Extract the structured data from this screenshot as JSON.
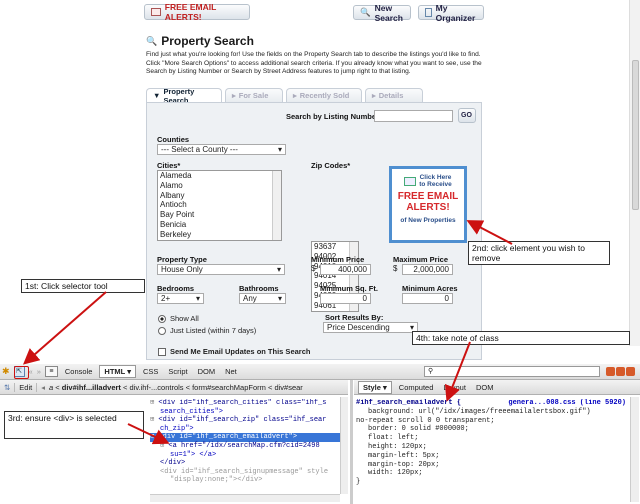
{
  "buttons": {
    "email_alerts": "FREE EMAIL ALERTS!",
    "new_search": "New Search",
    "organizer": "My Organizer"
  },
  "page": {
    "title": "Property Search",
    "intro": "Find just what you're looking for! Use the fields on the Property Search tab to describe the listings you'd like to find. Click \"More Search Options\" to access additional search criteria. If you already know what you want to see, use the Search by Listing Number or Search by Street Address features to jump right to that listing."
  },
  "tabs": [
    "Property Search",
    "For Sale",
    "Recently Sold",
    "Details"
  ],
  "listing": {
    "label": "Search by Listing Number:",
    "go": "GO"
  },
  "counties": {
    "label": "Counties",
    "selected": "--- Select a County ---"
  },
  "cities": {
    "label": "Cities*",
    "items": [
      "Alameda",
      "Alamo",
      "Albany",
      "Antioch",
      "Bay Point",
      "Benicia",
      "Berkeley"
    ]
  },
  "zips": {
    "label": "Zip Codes*",
    "items": [
      "93637",
      "94002",
      "94010",
      "94014",
      "94025",
      "94030",
      "94061"
    ]
  },
  "ad": {
    "click": "Click Here",
    "receive": "to Receive",
    "line1": "FREE EMAIL",
    "line2": "ALERTS!",
    "footer": "of New Properties"
  },
  "property_type": {
    "label": "Property Type",
    "value": "House Only"
  },
  "min_price": {
    "label": "Minimum Price",
    "currency": "$",
    "value": "400,000"
  },
  "max_price": {
    "label": "Maximum Price",
    "currency": "$",
    "value": "2,000,000"
  },
  "bedrooms": {
    "label": "Bedrooms",
    "value": "2+"
  },
  "bathrooms": {
    "label": "Bathrooms",
    "value": "Any"
  },
  "min_sqft": {
    "label": "Minimum Sq. Ft.",
    "value": "0"
  },
  "min_acres": {
    "label": "Minimum Acres",
    "value": "0"
  },
  "show": {
    "all": "Show All",
    "recent": "Just Listed (within 7 days)"
  },
  "sort": {
    "label": "Sort Results By:",
    "value": "Price Descending"
  },
  "email_updates": "Send Me Email Updates on This Search",
  "annotations": {
    "a1": "1st: Click selector tool",
    "a2": "2nd: click element you wish to remove",
    "a3": "3rd: ensure <div> is selected",
    "a4": "4th: take note of class"
  },
  "firebug": {
    "tabs": {
      "console": "Console",
      "html": "HTML",
      "css": "CSS",
      "script": "Script",
      "dom": "DOM",
      "net": "Net"
    },
    "edit": "Edit",
    "breadcrumb": [
      "div#ihf...illadvert",
      "div.ihf-...controls",
      "form#searchMapForm",
      "div#sear"
    ],
    "right_tabs": {
      "style": "Style",
      "computed": "Computed",
      "layout": "Layout",
      "dom": "DOM"
    },
    "html_lines": [
      {
        "indent": 0,
        "tag": "<div id=\"ihf_search_cities\" class=\"ihf_s",
        "cont": "search_cities\">"
      },
      {
        "indent": 0,
        "tag": "<div id=\"ihf_search_zip\" class=\"ihf_sear",
        "cont": "ch_zip\">"
      },
      {
        "indent": 0,
        "tag": "<div id=\"ihf_search_emailadvert\">",
        "cont": ""
      },
      {
        "indent": 1,
        "tag": "<a href=\"/idx/searchMap.cfm?cid=2498",
        "cont": "su=1\"> </a>"
      },
      {
        "indent": 0,
        "tag": "</div>",
        "cont": ""
      },
      {
        "indent": 0,
        "tag": "<div id=\"ihf_search_signupmessage\" style",
        "cont": "\"display:none;\"></div>"
      }
    ],
    "css_selector": "#ihf_search_emailadvert {",
    "css_source": "genera...008.css (line 5920)",
    "css_lines": [
      "background: url(\"/idx/images/freeemailalertsbox.gif\")",
      "no-repeat scroll 0 0 transparent;",
      "border: 0 solid #000000;",
      "float: left;",
      "height: 120px;",
      "margin-left: 5px;",
      "margin-top: 20px;",
      "width: 120px;",
      "}"
    ]
  },
  "colors": {
    "accent": "#d6282b",
    "frame_blue": "#4f8fd0",
    "arrow": "#cc1111"
  }
}
